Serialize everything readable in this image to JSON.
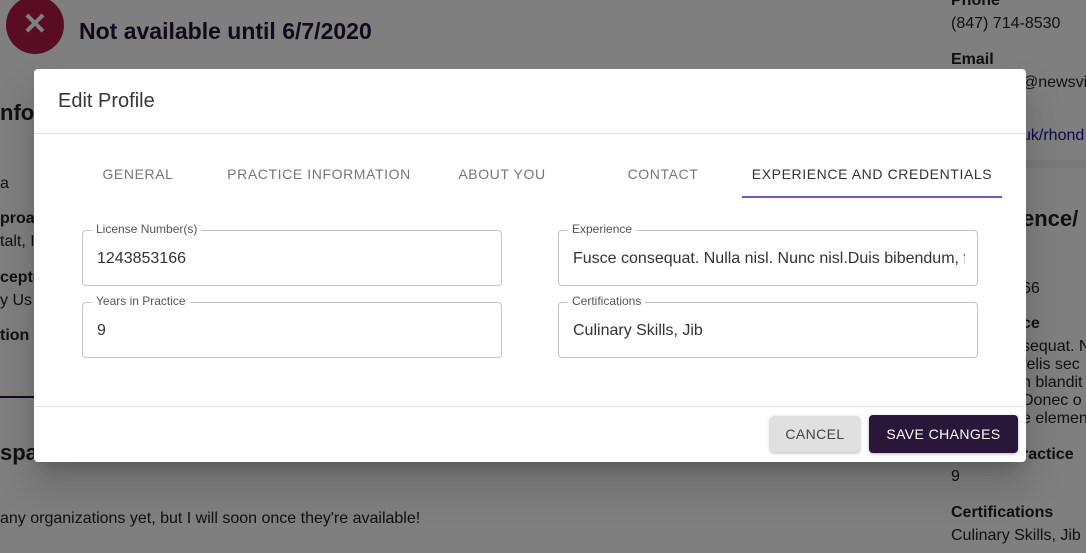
{
  "background": {
    "availability": "Not available until 6/7/2020",
    "left_fragments": [
      "nfo",
      "a",
      "proac",
      "talt, I",
      "cepte",
      "y Us",
      "tion",
      "spa"
    ],
    "org_text": "any organizations yet, but I will soon once they're available!",
    "right_panel": {
      "phone_label": "Phone",
      "phone_value": "(847) 714-8530",
      "email_label": "Email",
      "email_value": "@newsvi",
      "link_value": "uk/rhond",
      "section_heading": "ence/",
      "license_value": "66",
      "experience_label": "ce",
      "experience_lines": [
        "sequat. N",
        "felis sec",
        "n blandit",
        "Donec o",
        "e elemen"
      ],
      "years_label": "ractice",
      "years_value": "9",
      "certifications_label": "Certifications",
      "certifications_value": "Culinary Skills, Jib"
    }
  },
  "dialog": {
    "title": "Edit Profile",
    "tabs": [
      {
        "label": "GENERAL",
        "active": false
      },
      {
        "label": "PRACTICE INFORMATION",
        "active": false
      },
      {
        "label": "ABOUT YOU",
        "active": false
      },
      {
        "label": "CONTACT",
        "active": false
      },
      {
        "label": "EXPERIENCE AND CREDENTIALS",
        "active": true
      }
    ],
    "fields": {
      "license": {
        "label": "License Number(s)",
        "value": "1243853166"
      },
      "experience": {
        "label": "Experience",
        "value": "Fusce consequat. Nulla nisl. Nunc nisl.Duis bibendum, felis sed"
      },
      "years": {
        "label": "Years in Practice",
        "value": "9"
      },
      "certifications": {
        "label": "Certifications",
        "value": "Culinary Skills, Jib"
      }
    },
    "cancel_label": "CANCEL",
    "save_label": "SAVE CHANGES"
  },
  "colors": {
    "status_icon": "#b7194a",
    "accent_tab_indicator": "#7b52b9",
    "save_button": "#291638",
    "overlay": "rgba(0,0,0,0.5)"
  },
  "icons": {
    "status": "close-icon"
  }
}
